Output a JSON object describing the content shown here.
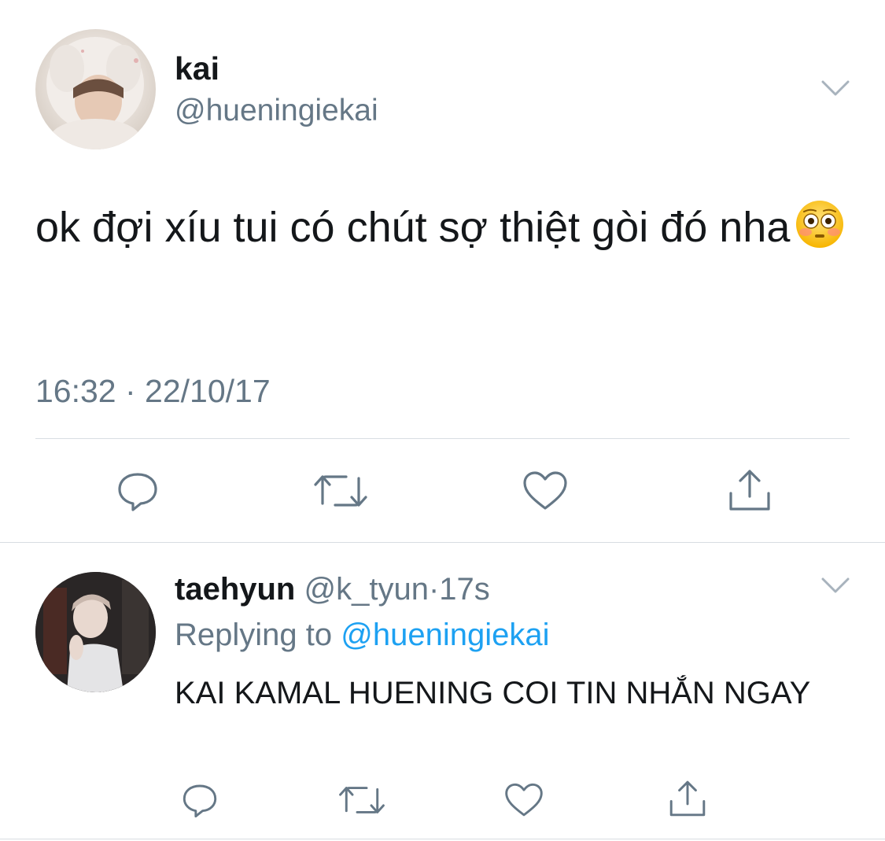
{
  "tweet": {
    "author_name": "kai",
    "author_handle": "@hueningiekai",
    "text": "ok đợi xíu tui có chút sợ thiệt gòi đó nha",
    "emoji": "flushed-face",
    "timestamp": "16:32 · 22/10/17",
    "actions": [
      "reply-icon",
      "retweet-icon",
      "like-icon",
      "share-icon"
    ]
  },
  "reply": {
    "author_name": "taehyun",
    "author_handle": "@k_tyun",
    "separator": "·",
    "time": "17s",
    "replying_label": "Replying to",
    "replying_to": "@hueningiekai",
    "text": "KAI KAMAL HUENING COI TIN NHẮN NGAY",
    "actions": [
      "reply-icon",
      "retweet-icon",
      "like-icon",
      "share-icon"
    ]
  },
  "colors": {
    "text": "#14171a",
    "secondary": "#657786",
    "link": "#1da1f2",
    "divider": "#d8dde2",
    "icon": "#657786"
  }
}
